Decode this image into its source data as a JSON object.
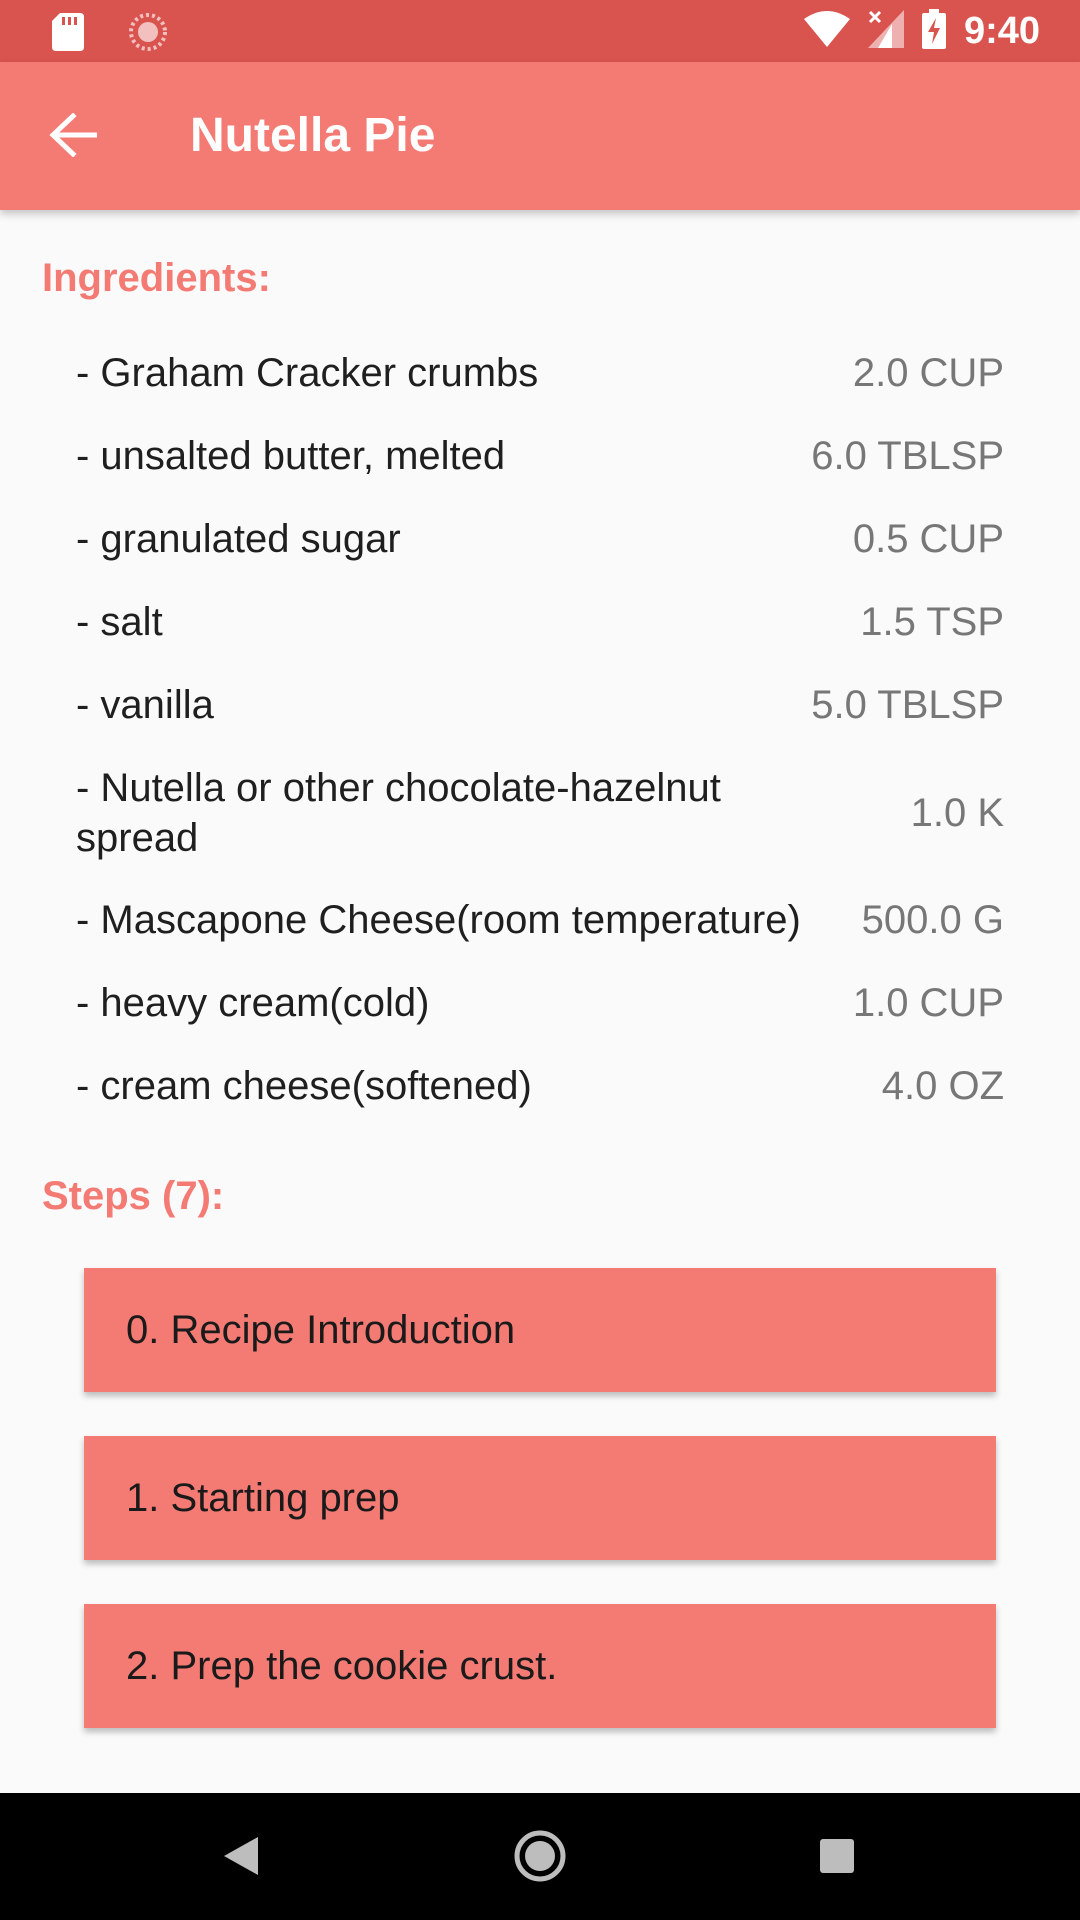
{
  "status_bar": {
    "time": "9:40",
    "icons": [
      "sd-card-icon",
      "sync-icon",
      "wifi-icon",
      "signal-icon",
      "battery-charging-icon"
    ]
  },
  "app_bar": {
    "title": "Nutella Pie",
    "back_icon": "arrow-back-icon"
  },
  "ingredients": {
    "heading": "Ingredients:",
    "items": [
      {
        "name": "- Graham Cracker crumbs",
        "qty": "2.0 CUP"
      },
      {
        "name": "- unsalted butter, melted",
        "qty": "6.0 TBLSP"
      },
      {
        "name": "- granulated sugar",
        "qty": "0.5 CUP"
      },
      {
        "name": "- salt",
        "qty": "1.5 TSP"
      },
      {
        "name": "- vanilla",
        "qty": "5.0 TBLSP"
      },
      {
        "name": "- Nutella or other chocolate-hazelnut spread",
        "qty": "1.0 K"
      },
      {
        "name": "- Mascapone Cheese(room temperature)",
        "qty": "500.0 G"
      },
      {
        "name": "- heavy cream(cold)",
        "qty": "1.0 CUP"
      },
      {
        "name": "- cream cheese(softened)",
        "qty": "4.0 OZ"
      }
    ]
  },
  "steps": {
    "heading": "Steps (7):",
    "items": [
      {
        "label": "0. Recipe Introduction"
      },
      {
        "label": "1. Starting prep"
      },
      {
        "label": "2. Prep the cookie crust."
      }
    ]
  },
  "nav_bar": {
    "icons": [
      "back-triangle-icon",
      "home-circle-icon",
      "recents-square-icon"
    ]
  },
  "colors": {
    "status_bar": "#d9534f",
    "accent": "#f47a74",
    "background": "#fafafa"
  }
}
